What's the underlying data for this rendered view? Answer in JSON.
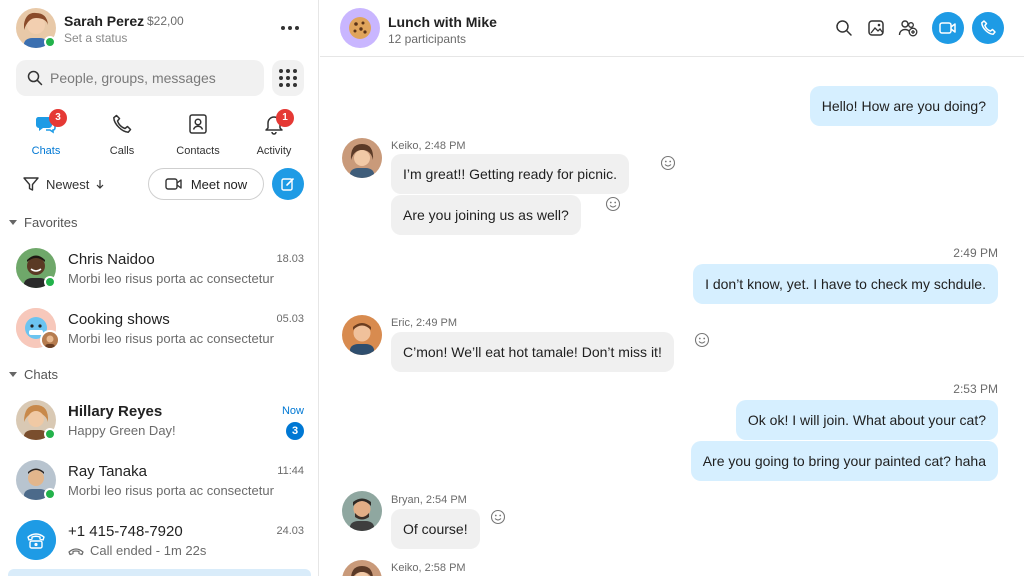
{
  "profile": {
    "name": "Sarah Perez",
    "credit": "$22,00",
    "status": "Set a status"
  },
  "search": {
    "placeholder": "People, groups, messages"
  },
  "nav": {
    "chats": {
      "label": "Chats",
      "badge": "3"
    },
    "calls": {
      "label": "Calls"
    },
    "contacts": {
      "label": "Contacts"
    },
    "activity": {
      "label": "Activity",
      "badge": "1"
    }
  },
  "filters": {
    "sort_label": "Newest",
    "meet_label": "Meet now"
  },
  "sections": {
    "favorites": "Favorites",
    "chats": "Chats"
  },
  "favorites": [
    {
      "name": "Chris Naidoo",
      "preview": "Morbi leo risus porta ac consectetur",
      "time": "18.03"
    },
    {
      "name": "Cooking shows",
      "preview": "Morbi leo risus porta ac consectetur",
      "time": "05.03"
    }
  ],
  "chats": [
    {
      "name": "Hillary Reyes",
      "preview": "Happy Green Day!",
      "time": "Now",
      "unread": "3"
    },
    {
      "name": "Ray Tanaka",
      "preview": "Morbi leo risus porta ac consectetur",
      "time": "11:44"
    },
    {
      "name": "+1 415-748-7920",
      "preview": "Call ended - 1m 22s",
      "time": "24.03"
    }
  ],
  "conversation": {
    "title": "Lunch with Mike",
    "participants": "12 participants",
    "messages": {
      "m1": "Hello! How are you doing?",
      "keiko_meta": "Keiko, 2:48 PM",
      "m2": "I’m great!! Getting ready for picnic.",
      "m3": "Are you joining us as well?",
      "t1": "2:49 PM",
      "m4": "I don’t know, yet. I have to check my schdule.",
      "eric_meta": "Eric, 2:49 PM",
      "m5": "C’mon! We’ll eat hot tamale! Don’t miss it!",
      "t2": "2:53 PM",
      "m6": "Ok ok! I will join. What about your cat?",
      "m7": "Are you going to bring your painted cat? haha",
      "bryan_meta": "Bryan, 2:54 PM",
      "m8": "Of course!",
      "keiko_meta2": "Keiko, 2:58 PM"
    }
  },
  "colors": {
    "accent": "#1e9be5",
    "outgoing_bubble": "#d6efff",
    "incoming_bubble": "#f0f0f0",
    "presence": "#23b24b",
    "badge": "#e53935"
  }
}
